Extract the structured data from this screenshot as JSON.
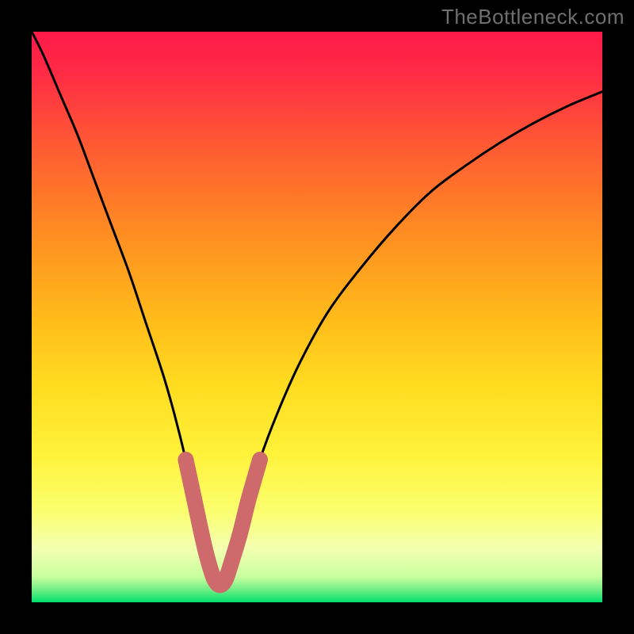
{
  "watermark": "TheBottleneck.com",
  "colors": {
    "frame": "#000000",
    "gradient_top": "#ff1a49",
    "gradient_mid1": "#ff6e2d",
    "gradient_mid2": "#ffc21a",
    "gradient_mid3": "#ffee33",
    "gradient_mid4": "#f6ff7a",
    "gradient_bottom_band": "#d9ffb3",
    "gradient_bottom": "#00e06a",
    "curve": "#000000",
    "overlay": "#cf6a6c"
  },
  "chart_data": {
    "type": "line",
    "title": "",
    "xlabel": "",
    "ylabel": "",
    "xlim": [
      0,
      100
    ],
    "ylim": [
      0,
      100
    ],
    "grid": false,
    "legend": false,
    "series": [
      {
        "name": "bottleneck-curve",
        "x": [
          0,
          2,
          5,
          8,
          11,
          14,
          17,
          20,
          23,
          25,
          27,
          28.5,
          30,
          31,
          32,
          33,
          34,
          35,
          36.5,
          38,
          40,
          43,
          47,
          52,
          58,
          64,
          70,
          76,
          82,
          88,
          94,
          100
        ],
        "y": [
          100,
          96,
          89,
          82,
          74,
          66,
          58,
          49,
          40,
          33,
          25,
          18,
          11,
          7,
          4,
          3,
          4,
          7,
          12,
          18,
          25,
          33,
          42,
          51,
          59,
          66,
          72,
          76.5,
          80.5,
          84,
          87,
          89.5
        ]
      }
    ],
    "overlay_segment": {
      "name": "bottleneck-sweet-spot",
      "x_start": 27,
      "x_end": 40,
      "note": "thick pink band drawn over curve trough"
    }
  }
}
